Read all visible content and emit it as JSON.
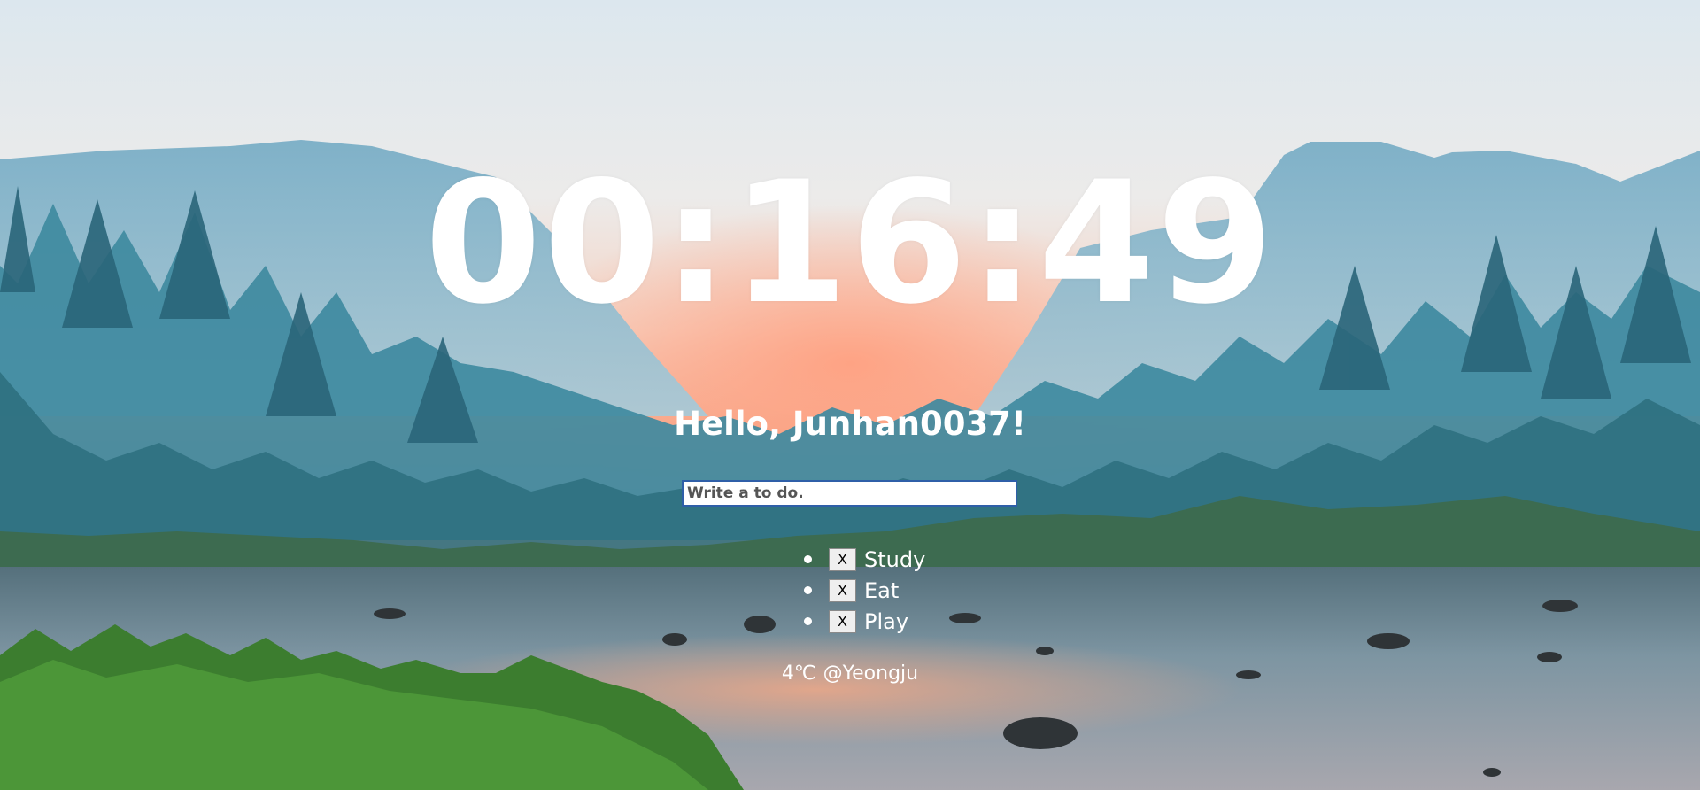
{
  "background": {
    "description_icon": "mountain-lake-landscape-image",
    "colors": {
      "sky_top": "#e6eef3",
      "sky_glow": "#f4a98a",
      "mountain": "#7fb0c6",
      "forest": "#2f6f82",
      "river": "#6f8fa0",
      "grass": "#3f8a3a"
    }
  },
  "clock": {
    "time": "00:16:49"
  },
  "greeting": {
    "text": "Hello, Junhan0037!"
  },
  "todo": {
    "placeholder": "Write a to do.",
    "value": "",
    "items": [
      {
        "delete_label": "X",
        "text": "Study"
      },
      {
        "delete_label": "X",
        "text": "Eat"
      },
      {
        "delete_label": "X",
        "text": "Play"
      }
    ]
  },
  "weather": {
    "temperature": "4℃",
    "location": "@Yeongju"
  }
}
